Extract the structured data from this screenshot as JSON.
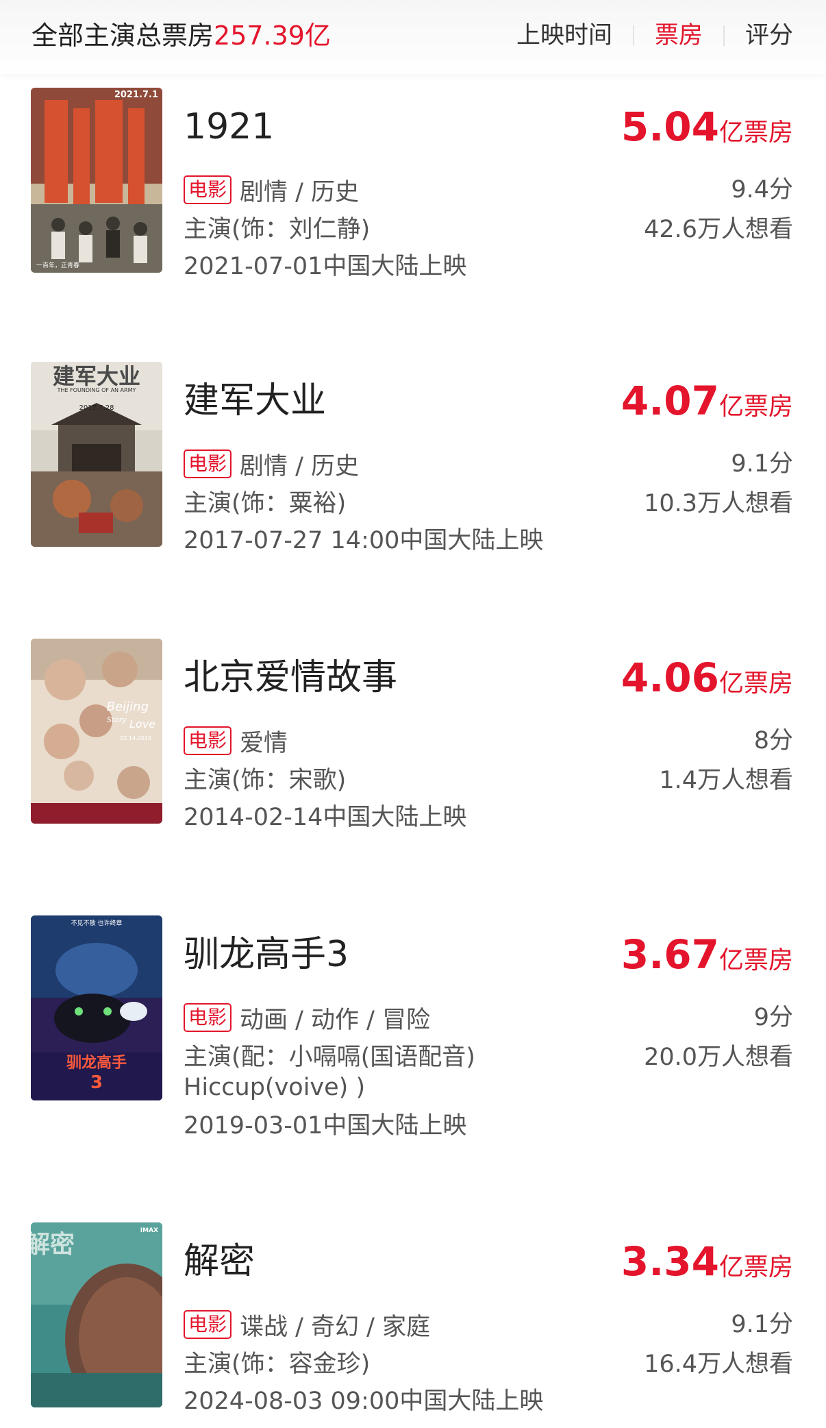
{
  "header": {
    "summary_label": "全部主演总票房",
    "summary_total": "257.39亿",
    "sort_tabs": [
      "上映时间",
      "票房",
      "评分"
    ],
    "active_tab": "票房"
  },
  "colors": {
    "accent": "#e3142b",
    "text": "#333333",
    "muted": "#555555"
  },
  "movies": [
    {
      "title": "1921",
      "box_office": "5.04",
      "box_unit": "亿票房",
      "tag": "电影",
      "genres": "剧情 / 历史",
      "cast_lines": [
        "主演(饰：刘仁静)"
      ],
      "release": "2021-07-01中国大陆上映",
      "score": "9.4分",
      "want": "42.6万人想看",
      "poster_texts": [
        "2021.7.1",
        "一百年，正青春"
      ]
    },
    {
      "title": "建军大业",
      "box_office": "4.07",
      "box_unit": "亿票房",
      "tag": "电影",
      "genres": "剧情 / 历史",
      "cast_lines": [
        "主演(饰：粟裕)"
      ],
      "release": "2017-07-27 14:00中国大陆上映",
      "score": "9.1分",
      "want": "10.3万人想看",
      "poster_texts": [
        "建军大业",
        "THE FOUNDING OF AN ARMY",
        "2017.7.28"
      ]
    },
    {
      "title": "北京爱情故事",
      "box_office": "4.06",
      "box_unit": "亿票房",
      "tag": "电影",
      "genres": "爱情",
      "cast_lines": [
        "主演(饰：宋歌)"
      ],
      "release": "2014-02-14中国大陆上映",
      "score": "8分",
      "want": "1.4万人想看",
      "poster_texts": [
        "Beijing",
        "Love",
        "Story",
        "02.14.2014"
      ]
    },
    {
      "title": "驯龙高手3",
      "box_office": "3.67",
      "box_unit": "亿票房",
      "tag": "电影",
      "genres": "动画 / 动作 / 冒险",
      "cast_lines": [
        "主演(配：小嗝嗝(国语配音)",
        "Hiccup(voive) )"
      ],
      "release": "2019-03-01中国大陆上映",
      "score": "9分",
      "want": "20.0万人想看",
      "poster_texts": [
        "不见不散 也许终章",
        "驯龙高手",
        "3"
      ]
    },
    {
      "title": "解密",
      "box_office": "3.34",
      "box_unit": "亿票房",
      "tag": "电影",
      "genres": "谍战 / 奇幻 / 家庭",
      "cast_lines": [
        "主演(饰：容金珍)"
      ],
      "release": "2024-08-03 09:00中国大陆上映",
      "score": "9.1分",
      "want": "16.4万人想看",
      "poster_texts": [
        "解密",
        "IMAX"
      ]
    }
  ]
}
